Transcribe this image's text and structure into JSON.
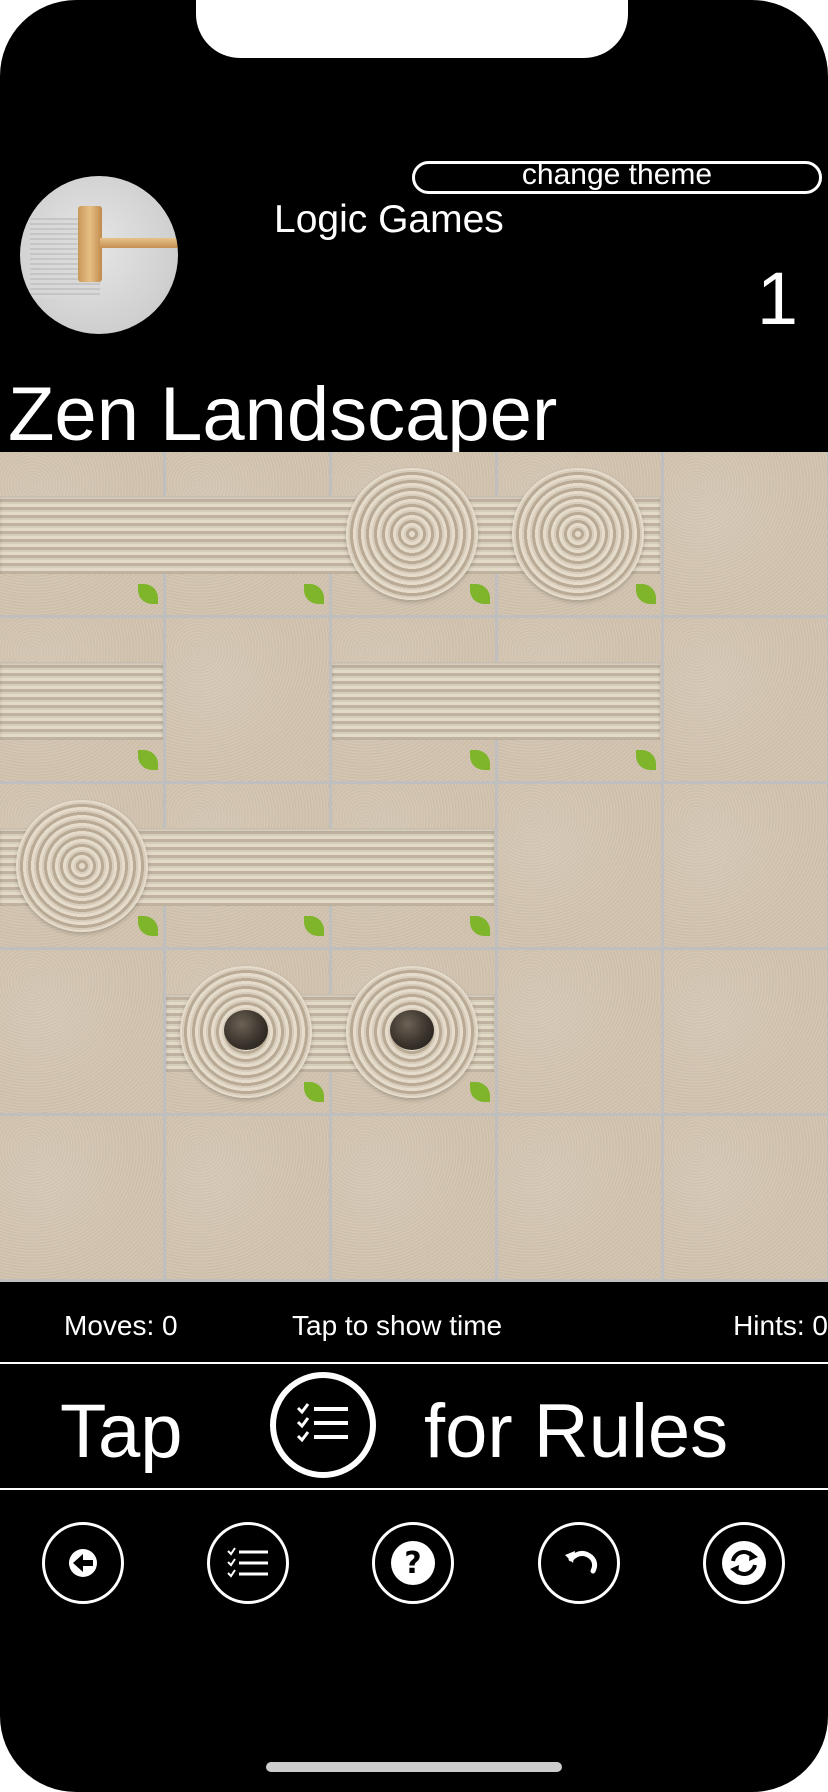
{
  "header": {
    "theme_button_label": "change theme",
    "app_name": "Logic Games",
    "level_number": "1",
    "game_title": "Zen Landscaper"
  },
  "stats": {
    "moves": "Moves: 0",
    "timer": "Tap to show time",
    "hints": "Hints: 0"
  },
  "rules_bar": {
    "left_text": "Tap",
    "right_text": "for Rules"
  },
  "toolbar": {
    "buttons": [
      "back-arrow-icon",
      "rules-list-icon",
      "question-icon",
      "undo-icon",
      "refresh-icon"
    ]
  },
  "colors": {
    "background": "#000000",
    "text": "#ffffff",
    "sand": "#cbbca8",
    "grid_line": "#bfbfbf",
    "leaf": "#7fb52a"
  }
}
